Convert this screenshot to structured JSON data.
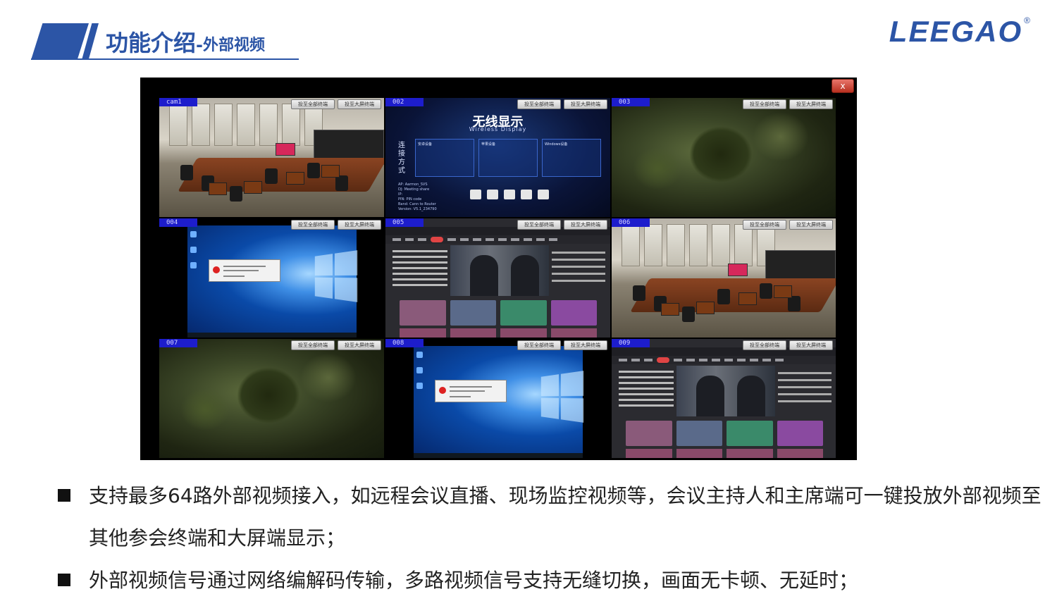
{
  "header": {
    "title_main": "功能介绍",
    "title_sep": "-",
    "title_sub": "外部视频"
  },
  "logo": {
    "text": "LEEGAO",
    "reg_mark": "®"
  },
  "screen": {
    "close_label": "x",
    "tiles": [
      {
        "label": "cam1",
        "scene": "room",
        "btn1": "投至全部终端",
        "btn2": "投至大屏终端"
      },
      {
        "label": "002",
        "scene": "wireless",
        "btn1": "投至全部终端",
        "btn2": "投至大屏终端",
        "title": "无线显示",
        "subtitle": "Wireless Display",
        "side_text": "连接方式",
        "panels": [
          "安卓设备",
          "苹果设备",
          "Windows设备"
        ],
        "info_lines": [
          "AP: Aarmon_SVS",
          "DJ: Meeting share",
          "IP:",
          "PIN: PIN code",
          "Band: Cann to Router",
          "Version: V5.1_234790"
        ]
      },
      {
        "label": "003",
        "scene": "dark",
        "btn1": "投至全部终端",
        "btn2": "投至大屏终端"
      },
      {
        "label": "004",
        "scene": "windows",
        "btn1": "投至全部终端",
        "btn2": "投至大屏终端"
      },
      {
        "label": "005",
        "scene": "app",
        "btn1": "投至全部终端",
        "btn2": "投至大屏终端"
      },
      {
        "label": "006",
        "scene": "room",
        "btn1": "投至全部终端",
        "btn2": "投至大屏终端"
      },
      {
        "label": "007",
        "scene": "dark",
        "btn1": "投至全部终端",
        "btn2": "投至大屏终端"
      },
      {
        "label": "008",
        "scene": "windows",
        "btn1": "投至全部终端",
        "btn2": "投至大屏终端"
      },
      {
        "label": "009",
        "scene": "app",
        "btn1": "投至全部终端",
        "btn2": "投至大屏终端"
      }
    ]
  },
  "bullets": [
    "支持最多64路外部视频接入，如远程会议直播、现场监控视频等，会议主持人和主席端可一键投放外部视频至其他参会终端和大屏端显示；",
    "外部视频信号通过网络编解码传输，多路视频信号支持无缝切换，画面无卡顿、无延时；"
  ],
  "colors": {
    "brand_blue": "#2c55a6",
    "label_blue": "#1d1dcc"
  }
}
